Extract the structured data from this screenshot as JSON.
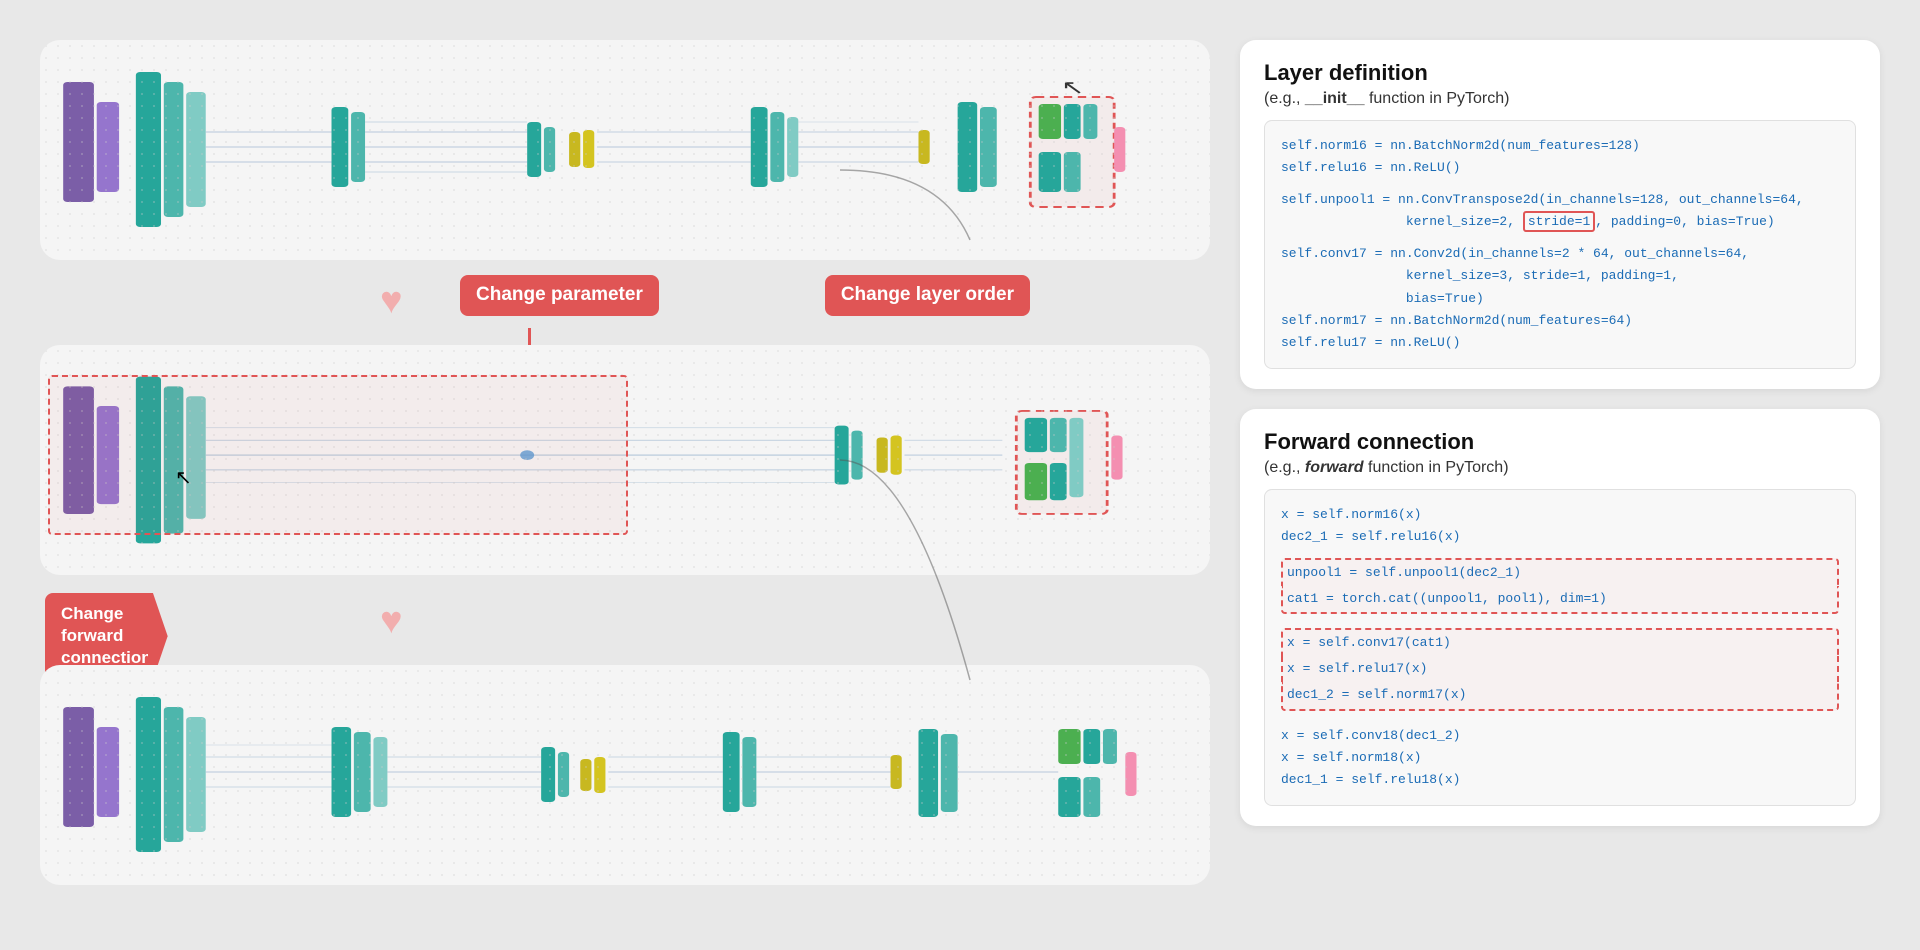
{
  "page": {
    "bg_color": "#e8e8e8"
  },
  "left": {
    "cards": [
      {
        "id": "top-card",
        "label": "Top network visualization"
      },
      {
        "id": "middle-card",
        "label": "Middle network visualization"
      },
      {
        "id": "bottom-card",
        "label": "Bottom network visualization"
      }
    ],
    "labels": {
      "change_parameter": "Change\nparameter",
      "change_layer_order": "Change\nlayer order",
      "change_forward_connection": "Change\nforward\nconnection"
    }
  },
  "right": {
    "layer_section": {
      "title": "Layer definition",
      "subtitle": "(e.g., __init__ function in PyTorch)",
      "code_lines": [
        "self.norm16 = nn.BatchNorm2d(num_features=128)",
        "self.relu16 = nn.ReLU()",
        "",
        "self.unpool1 = nn.ConvTranspose2d(in_channels=128, out_channels=64,",
        "                kernel_size=2, stride=1, padding=0, bias=True)",
        "",
        "self.conv17 = nn.Conv2d(in_channels=2 * 64, out_channels=64,",
        "                kernel_size=3, stride=1, padding=1,",
        "                bias=True)",
        "self.norm17 = nn.BatchNorm2d(num_features=64)",
        "self.relu17 = nn.ReLU()"
      ],
      "highlight_word": "stride=1"
    },
    "forward_section": {
      "title": "Forward connection",
      "subtitle": "(e.g., forward function in PyTorch)",
      "code_lines": [
        "x = self.norm16(x)",
        "dec2_1 = self.relu16(x)",
        "",
        "unpool1 = self.unpool1(dec2_1)",
        "cat1 = torch.cat((unpool1, pool1), dim=1)",
        "",
        "x = self.conv17(cat1)",
        "x = self.relu17(x)",
        "dec1_2 = self.norm17(x)",
        "",
        "x = self.conv18(dec1_2)",
        "x = self.norm18(x)",
        "dec1_1 = self.relu18(x)"
      ],
      "highlight_lines": [
        3,
        4
      ],
      "highlight_block_lines": [
        6,
        7,
        8
      ]
    }
  }
}
